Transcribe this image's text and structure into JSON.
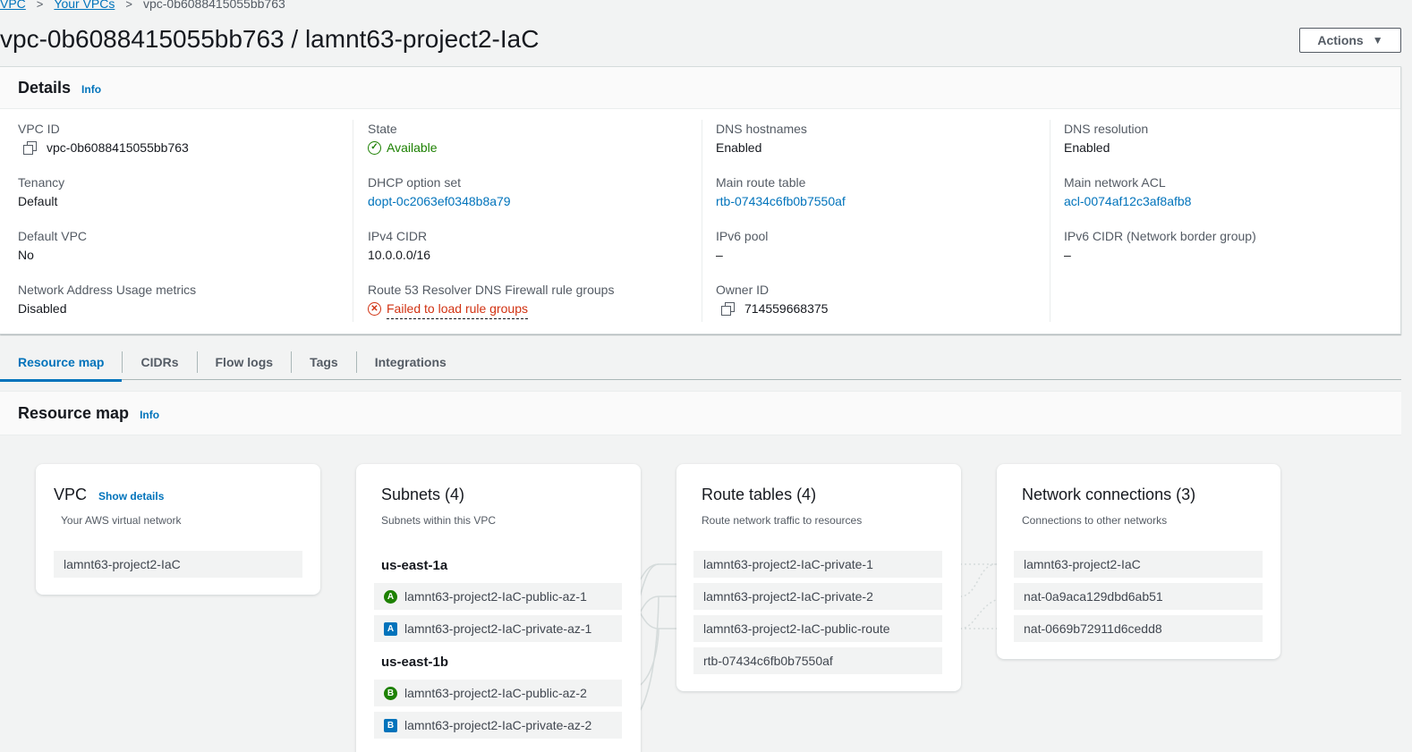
{
  "breadcrumb": {
    "items": [
      "VPC",
      "Your VPCs"
    ],
    "current": "vpc-0b6088415055bb763"
  },
  "page_title": "vpc-0b6088415055bb763 / lamnt63-project2-IaC",
  "actions_label": "Actions",
  "details": {
    "title": "Details",
    "info": "Info",
    "vpc_id": {
      "label": "VPC ID",
      "value": "vpc-0b6088415055bb763"
    },
    "state": {
      "label": "State",
      "value": "Available"
    },
    "dns_hostnames": {
      "label": "DNS hostnames",
      "value": "Enabled"
    },
    "dns_resolution": {
      "label": "DNS resolution",
      "value": "Enabled"
    },
    "tenancy": {
      "label": "Tenancy",
      "value": "Default"
    },
    "dhcp": {
      "label": "DHCP option set",
      "value": "dopt-0c2063ef0348b8a79"
    },
    "main_route_table": {
      "label": "Main route table",
      "value": "rtb-07434c6fb0b7550af"
    },
    "main_acl": {
      "label": "Main network ACL",
      "value": "acl-0074af12c3af8afb8"
    },
    "default_vpc": {
      "label": "Default VPC",
      "value": "No"
    },
    "ipv4_cidr": {
      "label": "IPv4 CIDR",
      "value": "10.0.0.0/16"
    },
    "ipv6_pool": {
      "label": "IPv6 pool",
      "value": "–"
    },
    "ipv6_cidr": {
      "label": "IPv6 CIDR (Network border group)",
      "value": "–"
    },
    "nau_metrics": {
      "label": "Network Address Usage metrics",
      "value": "Disabled"
    },
    "route53": {
      "label": "Route 53 Resolver DNS Firewall rule groups",
      "value": "Failed to load rule groups"
    },
    "owner_id": {
      "label": "Owner ID",
      "value": "714559668375"
    }
  },
  "tabs": [
    "Resource map",
    "CIDRs",
    "Flow logs",
    "Tags",
    "Integrations"
  ],
  "resource_map": {
    "title": "Resource map",
    "info": "Info",
    "vpc_card": {
      "title": "VPC",
      "show_details": "Show details",
      "subtitle": "Your AWS virtual network",
      "item": "lamnt63-project2-IaC"
    },
    "subnets_card": {
      "title": "Subnets (4)",
      "subtitle": "Subnets within this VPC",
      "zones": [
        {
          "name": "us-east-1a",
          "items": [
            {
              "badge": "A",
              "color": "green",
              "label": "lamnt63-project2-IaC-public-az-1"
            },
            {
              "badge": "A",
              "color": "blue",
              "label": "lamnt63-project2-IaC-private-az-1"
            }
          ]
        },
        {
          "name": "us-east-1b",
          "items": [
            {
              "badge": "B",
              "color": "green",
              "label": "lamnt63-project2-IaC-public-az-2"
            },
            {
              "badge": "B",
              "color": "blue",
              "label": "lamnt63-project2-IaC-private-az-2"
            }
          ]
        }
      ]
    },
    "route_tables_card": {
      "title": "Route tables (4)",
      "subtitle": "Route network traffic to resources",
      "items": [
        "lamnt63-project2-IaC-private-1",
        "lamnt63-project2-IaC-private-2",
        "lamnt63-project2-IaC-public-route",
        "rtb-07434c6fb0b7550af"
      ]
    },
    "network_card": {
      "title": "Network connections (3)",
      "subtitle": "Connections to other networks",
      "items": [
        "lamnt63-project2-IaC",
        "nat-0a9aca129dbd6ab51",
        "nat-0669b72911d6cedd8"
      ]
    }
  }
}
